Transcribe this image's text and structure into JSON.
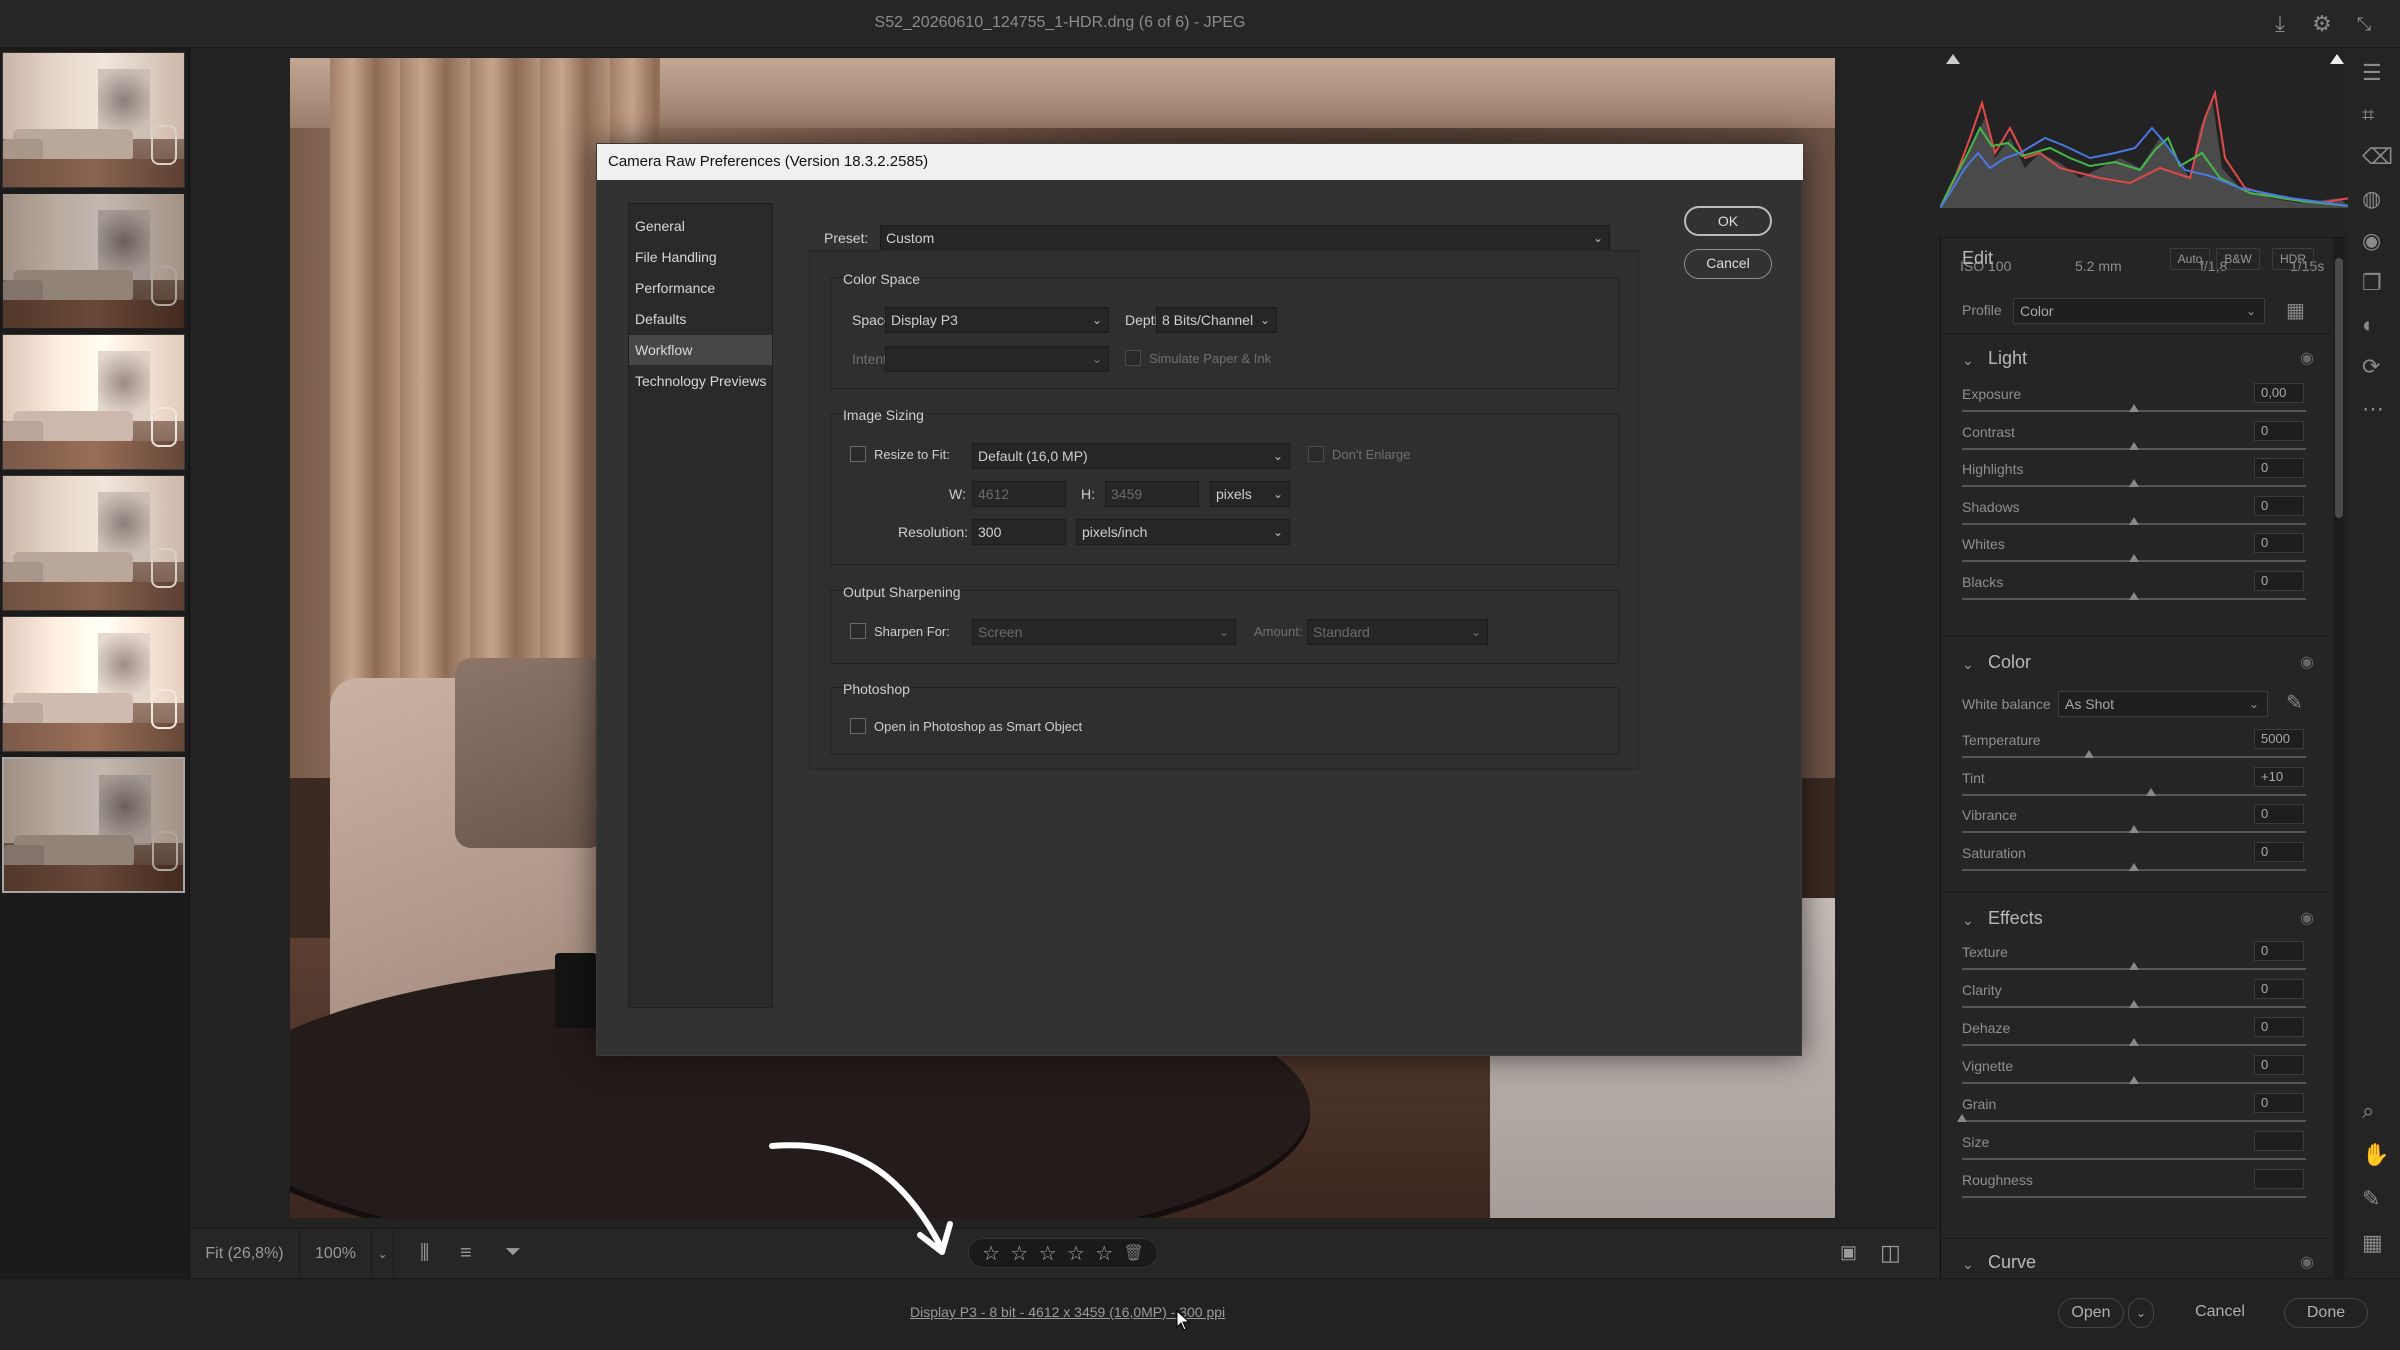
{
  "window": {
    "title": "S52_20260610_124755_1-HDR.dng (6 of 6)  -  JPEG",
    "icons": [
      "save-icon",
      "settings-icon",
      "collapse-icon"
    ]
  },
  "filmstrip": {
    "count": 6,
    "selected_index": 5
  },
  "toolbar": {
    "fit_label": "Fit (26,8%)",
    "zoom_label": "100%",
    "stars": [
      "☆",
      "☆",
      "☆",
      "☆",
      "☆"
    ]
  },
  "status": {
    "workflow_link": "Display P3 - 8 bit - 4612 x 3459 (16,0MP) - 300 ppi",
    "open_label": "Open",
    "cancel_label": "Cancel",
    "done_label": "Done"
  },
  "histogram": {
    "iso": "ISO 100",
    "focal": "5.2 mm",
    "aperture": "f/1,8",
    "shutter": "1/15s"
  },
  "edit_panel": {
    "edit_label": "Edit",
    "auto_label": "Auto",
    "bw_label": "B&W",
    "hdr_label": "HDR",
    "profile_label": "Profile",
    "profile_value": "Color",
    "light": {
      "title": "Light",
      "sliders": [
        {
          "label": "Exposure",
          "value": "0,00",
          "pos": 0.5
        },
        {
          "label": "Contrast",
          "value": "0",
          "pos": 0.5
        },
        {
          "label": "Highlights",
          "value": "0",
          "pos": 0.5
        },
        {
          "label": "Shadows",
          "value": "0",
          "pos": 0.5
        },
        {
          "label": "Whites",
          "value": "0",
          "pos": 0.5
        },
        {
          "label": "Blacks",
          "value": "0",
          "pos": 0.5
        }
      ]
    },
    "color": {
      "title": "Color",
      "wb_label": "White balance",
      "wb_value": "As Shot",
      "sliders": [
        {
          "label": "Temperature",
          "value": "5000",
          "pos": 0.37
        },
        {
          "label": "Tint",
          "value": "+10",
          "pos": 0.55
        },
        {
          "label": "Vibrance",
          "value": "0",
          "pos": 0.5
        },
        {
          "label": "Saturation",
          "value": "0",
          "pos": 0.5
        }
      ]
    },
    "effects": {
      "title": "Effects",
      "sliders": [
        {
          "label": "Texture",
          "value": "0",
          "pos": 0.5
        },
        {
          "label": "Clarity",
          "value": "0",
          "pos": 0.5
        },
        {
          "label": "Dehaze",
          "value": "0",
          "pos": 0.5
        },
        {
          "label": "Vignette",
          "value": "0",
          "pos": 0.5
        },
        {
          "label": "Grain",
          "value": "0",
          "pos": 0.0
        },
        {
          "label": "Size",
          "value": "",
          "pos": null
        },
        {
          "label": "Roughness",
          "value": "",
          "pos": null
        }
      ]
    },
    "curve": {
      "title": "Curve"
    }
  },
  "dialog": {
    "title": "Camera Raw Preferences  (Version 18.3.2.2585)",
    "nav": [
      "General",
      "File Handling",
      "Performance",
      "Defaults",
      "Workflow",
      "Technology Previews"
    ],
    "active_nav": "Workflow",
    "ok_label": "OK",
    "cancel_label": "Cancel",
    "preset_label": "Preset:",
    "preset_value": "Custom",
    "color_space": {
      "title": "Color Space",
      "space_label": "Space:",
      "space_value": "Display P3",
      "depth_label": "Depth:",
      "depth_value": "8 Bits/Channel",
      "intent_label": "Intent:",
      "intent_value": "",
      "simulate_label": "Simulate Paper & Ink"
    },
    "image_sizing": {
      "title": "Image Sizing",
      "resize_label": "Resize to Fit:",
      "resize_value": "Default  (16,0 MP)",
      "dont_enlarge_label": "Don't Enlarge",
      "w_label": "W:",
      "w_value": "4612",
      "h_label": "H:",
      "h_value": "3459",
      "unit_value": "pixels",
      "resolution_label": "Resolution:",
      "resolution_value": "300",
      "resolution_unit": "pixels/inch"
    },
    "output_sharpening": {
      "title": "Output Sharpening",
      "sharpen_label": "Sharpen For:",
      "sharpen_value": "Screen",
      "amount_label": "Amount:",
      "amount_value": "Standard"
    },
    "photoshop": {
      "title": "Photoshop",
      "smart_object_label": "Open in Photoshop as Smart Object"
    }
  }
}
